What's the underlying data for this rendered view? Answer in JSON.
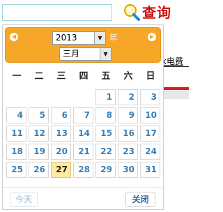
{
  "search": {
    "value": "",
    "query_label": "查询"
  },
  "background": {
    "fragment_text": "k电费"
  },
  "calendar": {
    "year": "2013",
    "year_suffix": "年",
    "month": "三月",
    "weekdays": [
      "一",
      "二",
      "三",
      "四",
      "五",
      "六",
      "日"
    ],
    "days": [
      {
        "day": "1",
        "col": 5,
        "row": 0
      },
      {
        "day": "2",
        "col": 6,
        "row": 0
      },
      {
        "day": "3",
        "col": 7,
        "row": 0
      },
      {
        "day": "4",
        "col": 1,
        "row": 1
      },
      {
        "day": "5",
        "col": 2,
        "row": 1
      },
      {
        "day": "6",
        "col": 3,
        "row": 1
      },
      {
        "day": "7",
        "col": 4,
        "row": 1
      },
      {
        "day": "8",
        "col": 5,
        "row": 1
      },
      {
        "day": "9",
        "col": 6,
        "row": 1
      },
      {
        "day": "10",
        "col": 7,
        "row": 1
      },
      {
        "day": "11",
        "col": 1,
        "row": 2
      },
      {
        "day": "12",
        "col": 2,
        "row": 2
      },
      {
        "day": "13",
        "col": 3,
        "row": 2
      },
      {
        "day": "14",
        "col": 4,
        "row": 2
      },
      {
        "day": "15",
        "col": 5,
        "row": 2
      },
      {
        "day": "16",
        "col": 6,
        "row": 2
      },
      {
        "day": "17",
        "col": 7,
        "row": 2
      },
      {
        "day": "18",
        "col": 1,
        "row": 3
      },
      {
        "day": "19",
        "col": 2,
        "row": 3
      },
      {
        "day": "20",
        "col": 3,
        "row": 3
      },
      {
        "day": "21",
        "col": 4,
        "row": 3
      },
      {
        "day": "22",
        "col": 5,
        "row": 3
      },
      {
        "day": "23",
        "col": 6,
        "row": 3
      },
      {
        "day": "24",
        "col": 7,
        "row": 3
      },
      {
        "day": "25",
        "col": 1,
        "row": 4
      },
      {
        "day": "26",
        "col": 2,
        "row": 4
      },
      {
        "day": "27",
        "col": 3,
        "row": 4
      },
      {
        "day": "28",
        "col": 4,
        "row": 4
      },
      {
        "day": "29",
        "col": 5,
        "row": 4
      },
      {
        "day": "30",
        "col": 6,
        "row": 4
      },
      {
        "day": "31",
        "col": 7,
        "row": 4
      }
    ],
    "selected_day": "27",
    "today_label": "今天",
    "close_label": "关闭",
    "colors": {
      "header": "#f6a728",
      "day_text": "#3a7fb5",
      "selected_bg": "#ffe9a6"
    }
  }
}
